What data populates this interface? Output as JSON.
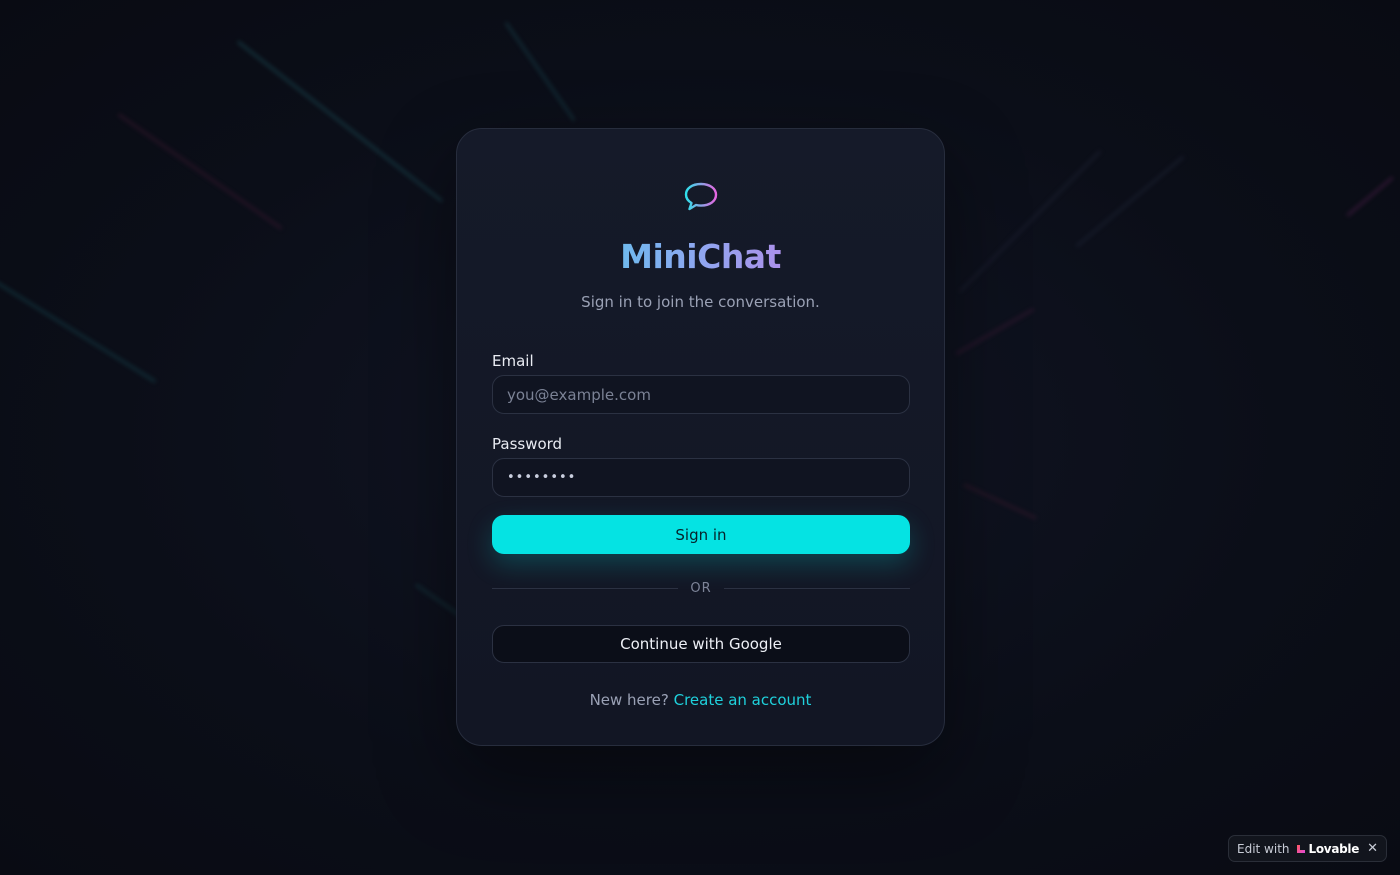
{
  "app": {
    "title": "MiniChat",
    "subtitle": "Sign in to join the conversation.",
    "logo_icon": "chat-bubble-icon",
    "accent": "#05e3e3",
    "gradient_start": "#2ee0ea",
    "gradient_end": "#e566e0"
  },
  "form": {
    "email_label": "Email",
    "email_placeholder": "you@example.com",
    "email_value": "",
    "password_label": "Password",
    "password_value": "password",
    "signin_label": "Sign in",
    "divider_text": "OR",
    "google_label": "Continue with Google"
  },
  "footer": {
    "prompt": "New here?",
    "link": "Create an account"
  },
  "badge": {
    "prefix": "Edit with",
    "brand": "Lovable",
    "close": "✕"
  }
}
